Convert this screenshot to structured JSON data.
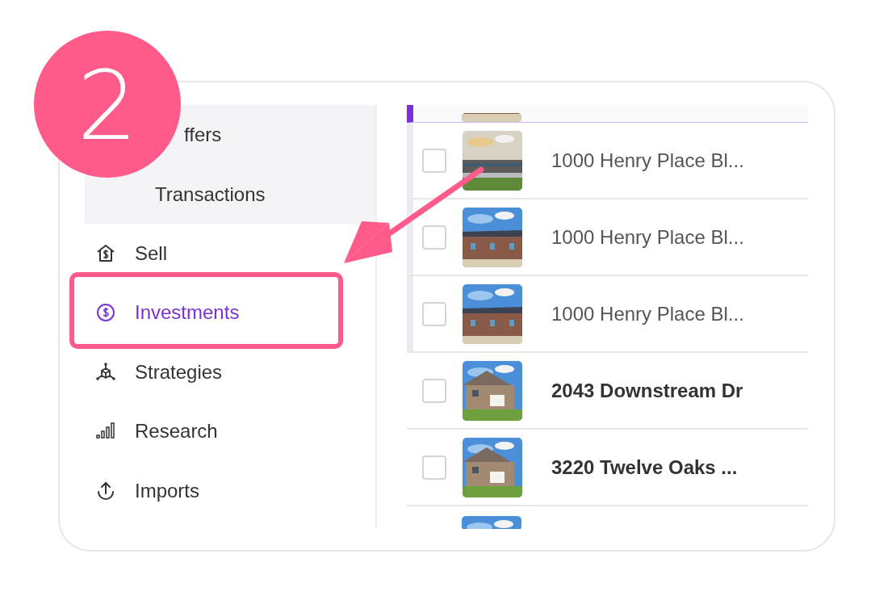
{
  "step_badge": "2",
  "sidebar": {
    "group": [
      {
        "label": "ffers"
      },
      {
        "label": "Transactions"
      }
    ],
    "items": [
      {
        "label": "Sell",
        "selected": false
      },
      {
        "label": "Investments",
        "selected": true
      },
      {
        "label": "Strategies",
        "selected": false
      },
      {
        "label": "Research",
        "selected": false
      },
      {
        "label": "Imports",
        "selected": false
      }
    ]
  },
  "listings": [
    {
      "kind": "cut"
    },
    {
      "kind": "unit",
      "checked": false,
      "address": "1000 Henry Place Bl..."
    },
    {
      "kind": "unit",
      "checked": false,
      "address": "1000 Henry Place Bl..."
    },
    {
      "kind": "unit",
      "checked": false,
      "address": "1000 Henry Place Bl..."
    },
    {
      "kind": "property",
      "checked": false,
      "address": "2043 Downstream Dr"
    },
    {
      "kind": "property",
      "checked": false,
      "address": "3220 Twelve Oaks ..."
    },
    {
      "kind": "cut"
    }
  ]
}
